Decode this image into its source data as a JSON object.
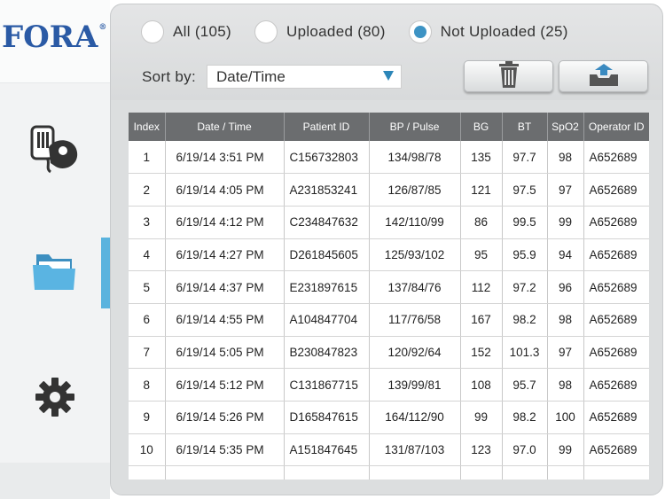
{
  "brand": {
    "logo_text": "FORA",
    "logo_mark": "®"
  },
  "sidebar": {
    "items": [
      {
        "name": "meter",
        "icon": "meter-device-icon"
      },
      {
        "name": "records",
        "icon": "folder-icon",
        "active": true
      },
      {
        "name": "settings",
        "icon": "gear-icon"
      }
    ],
    "accent_color": "#5bb3de"
  },
  "filters": {
    "options": [
      {
        "label": "All (105)",
        "selected": false
      },
      {
        "label": "Uploaded (80)",
        "selected": false
      },
      {
        "label": "Not Uploaded (25)",
        "selected": true
      }
    ]
  },
  "sort": {
    "label": "Sort by:",
    "value": "Date/Time"
  },
  "toolbar": {
    "delete_icon": "trash-icon",
    "upload_icon": "upload-icon"
  },
  "table": {
    "headers": [
      "Index",
      "Date / Time",
      "Patient ID",
      "BP / Pulse",
      "BG",
      "BT",
      "SpO2",
      "Operator ID"
    ],
    "rows": [
      [
        "1",
        "6/19/14 3:51 PM",
        "C156732803",
        "134/98/78",
        "135",
        "97.7",
        "98",
        "A652689"
      ],
      [
        "2",
        "6/19/14 4:05 PM",
        "A231853241",
        "126/87/85",
        "121",
        "97.5",
        "97",
        "A652689"
      ],
      [
        "3",
        "6/19/14 4:12 PM",
        "C234847632",
        "142/110/99",
        "86",
        "99.5",
        "99",
        "A652689"
      ],
      [
        "4",
        "6/19/14 4:27 PM",
        "D261845605",
        "125/93/102",
        "95",
        "95.9",
        "94",
        "A652689"
      ],
      [
        "5",
        "6/19/14 4:37 PM",
        "E231897615",
        "137/84/76",
        "112",
        "97.2",
        "96",
        "A652689"
      ],
      [
        "6",
        "6/19/14 4:55 PM",
        "A104847704",
        "117/76/58",
        "167",
        "98.2",
        "98",
        "A652689"
      ],
      [
        "7",
        "6/19/14 5:05 PM",
        "B230847823",
        "120/92/64",
        "152",
        "101.3",
        "97",
        "A652689"
      ],
      [
        "8",
        "6/19/14 5:12 PM",
        "C131867715",
        "139/99/81",
        "108",
        "95.7",
        "98",
        "A652689"
      ],
      [
        "9",
        "6/19/14 5:26 PM",
        "D165847615",
        "164/112/90",
        "99",
        "98.2",
        "100",
        "A652689"
      ],
      [
        "10",
        "6/19/14 5:35 PM",
        "A151847645",
        "131/87/103",
        "123",
        "97.0",
        "99",
        "A652689"
      ]
    ]
  }
}
